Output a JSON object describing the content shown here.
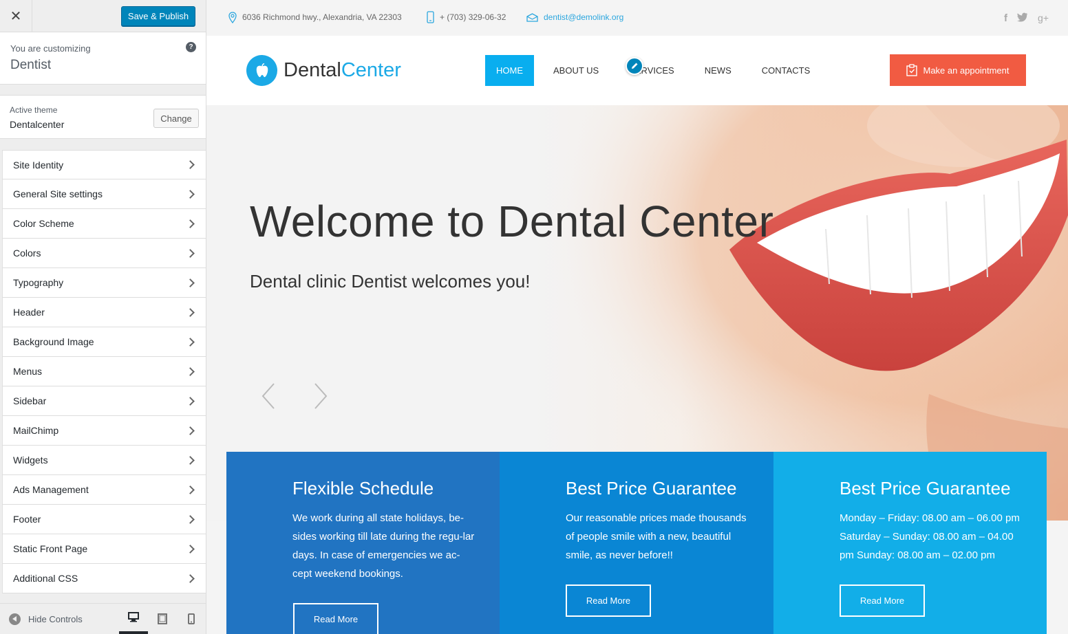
{
  "sidebar": {
    "close_label": "✕",
    "publish_label": "Save & Publish",
    "customizing_label": "You are customizing",
    "site_name": "Dentist",
    "help_label": "?",
    "active_theme_label": "Active theme",
    "theme_name": "Dentalcenter",
    "change_label": "Change",
    "items": [
      {
        "label": "Site Identity"
      },
      {
        "label": "General Site settings"
      },
      {
        "label": "Color Scheme"
      },
      {
        "label": "Colors"
      },
      {
        "label": "Typography"
      },
      {
        "label": "Header"
      },
      {
        "label": "Background Image"
      },
      {
        "label": "Menus"
      },
      {
        "label": "Sidebar"
      },
      {
        "label": "MailChimp"
      },
      {
        "label": "Widgets"
      },
      {
        "label": "Ads Management"
      },
      {
        "label": "Footer"
      },
      {
        "label": "Static Front Page"
      },
      {
        "label": "Additional CSS"
      }
    ],
    "hide_controls_label": "Hide Controls"
  },
  "topbar": {
    "address": "6036 Richmond hwy., Alexandria, VA 22303",
    "phone": "+ (703) 329-06-32",
    "email": "dentist@demolink.org"
  },
  "logo": {
    "part1": "Dental",
    "part2": "Center"
  },
  "nav": {
    "items": [
      {
        "label": "HOME"
      },
      {
        "label": "ABOUT US"
      },
      {
        "label": "SERVICES"
      },
      {
        "label": "NEWS"
      },
      {
        "label": "CONTACTS"
      }
    ]
  },
  "appointment_label": "Make an appointment",
  "hero": {
    "title": "Welcome to Dental Center",
    "subtitle": "Dental clinic Dentist welcomes you!"
  },
  "boxes": [
    {
      "title": "Flexible Schedule",
      "text": "We work during all state holidays, be-sides working till late during the regu-lar days. In case of emergencies we ac-cept weekend bookings.",
      "button": "Read More",
      "color": "#2174c2"
    },
    {
      "title": "Best Price Guarantee",
      "text": "Our reasonable prices made thousands of people smile with a new, beautiful smile, as never before!!",
      "button": "Read More",
      "color": "#0a86d4"
    },
    {
      "title": "Best Price Guarantee",
      "text": "Monday – Friday:  08.00 am – 06.00 pm Saturday – Sunday: 08.00 am – 04.00 pm Sunday: 08.00 am – 02.00 pm",
      "button": "Read More",
      "color": "#12aee8"
    }
  ],
  "colors": {
    "accent": "#09aeef",
    "publish": "#0085ba",
    "appointment": "#f15b42"
  },
  "icons": {
    "topbar": [
      "map-pin-icon",
      "phone-icon",
      "envelope-icon"
    ],
    "socials": [
      "facebook-icon",
      "twitter-icon",
      "google-plus-icon"
    ],
    "devices": [
      "desktop-icon",
      "tablet-icon",
      "mobile-icon"
    ]
  }
}
